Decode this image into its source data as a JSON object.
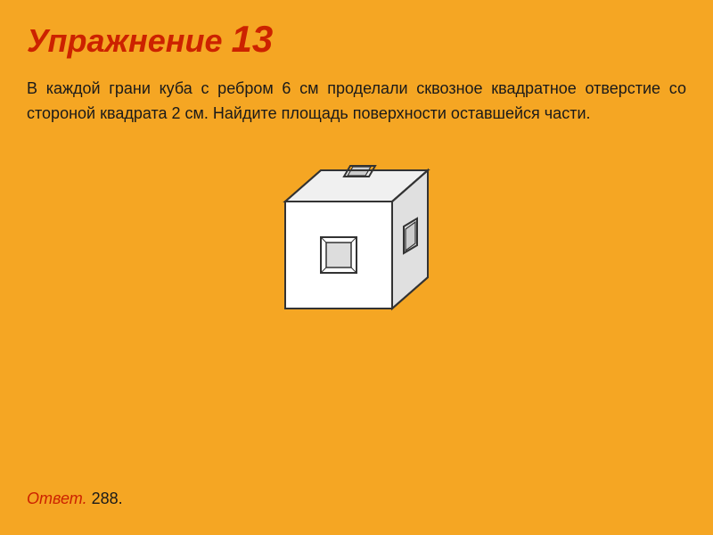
{
  "page": {
    "background_color": "#F5A623",
    "title": {
      "prefix": "Упражнение ",
      "number": "13"
    },
    "problem_text": "В каждой грани куба с ребром 6 см проделали сквозное квадратное отверстие со стороной квадрата 2 см. Найдите площадь поверхности оставшейся части.",
    "answer": {
      "label": "Ответ.",
      "value": " 288."
    }
  }
}
